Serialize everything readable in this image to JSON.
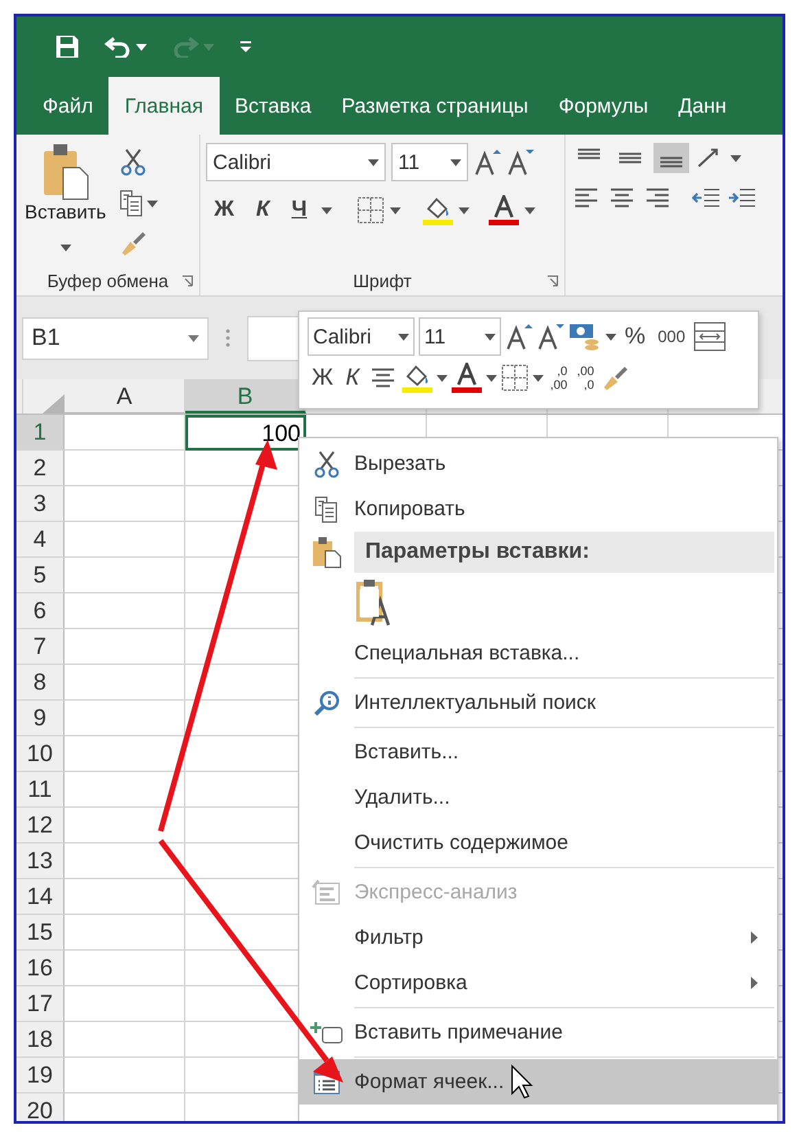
{
  "quick_access": [
    {
      "kind": "save",
      "disabled": false
    },
    {
      "kind": "undo",
      "disabled": false
    },
    {
      "kind": "redo",
      "disabled": true
    },
    {
      "kind": "customize",
      "disabled": false
    }
  ],
  "tabs": [
    {
      "label": "Файл",
      "selected": false
    },
    {
      "label": "Главная",
      "selected": true
    },
    {
      "label": "Вставка",
      "selected": false
    },
    {
      "label": "Разметка страницы",
      "selected": false
    },
    {
      "label": "Формулы",
      "selected": false
    },
    {
      "label": "Данн",
      "selected": false
    }
  ],
  "ribbon": {
    "clipboard": {
      "paste_label": "Вставить",
      "group_label": "Буфер обмена"
    },
    "font": {
      "font_name": "Calibri",
      "font_size": "11",
      "bold": "Ж",
      "italic": "К",
      "underline": "Ч",
      "group_label": "Шрифт"
    },
    "alignment": [
      {
        "kind": "top",
        "selected": false
      },
      {
        "kind": "middle",
        "selected": false
      },
      {
        "kind": "bottom",
        "selected": true
      }
    ]
  },
  "name_box": "B1",
  "mini_toolbar": {
    "font_name": "Calibri",
    "font_size": "11",
    "percent": "%",
    "thousands": "000",
    "bold": "Ж",
    "italic": "К",
    "increase_decimal": [
      ",0",
      ",00"
    ],
    "decrease_decimal": [
      ",00",
      ",0"
    ]
  },
  "sheet": {
    "columns": [
      {
        "label": "A",
        "selected": false
      },
      {
        "label": "B",
        "selected": true
      }
    ],
    "rows": [
      {
        "label": "1",
        "selected": true,
        "cells": [
          {},
          {
            "text": "100",
            "selected": true
          }
        ]
      },
      {
        "label": "2",
        "selected": false
      },
      {
        "label": "3",
        "selected": false
      },
      {
        "label": "4",
        "selected": false
      },
      {
        "label": "5",
        "selected": false
      },
      {
        "label": "6",
        "selected": false
      },
      {
        "label": "7",
        "selected": false
      },
      {
        "label": "8",
        "selected": false
      },
      {
        "label": "9",
        "selected": false
      },
      {
        "label": "10",
        "selected": false
      },
      {
        "label": "11",
        "selected": false
      },
      {
        "label": "12",
        "selected": false
      },
      {
        "label": "13",
        "selected": false
      },
      {
        "label": "14",
        "selected": false
      },
      {
        "label": "15",
        "selected": false
      },
      {
        "label": "16",
        "selected": false
      },
      {
        "label": "17",
        "selected": false
      },
      {
        "label": "18",
        "selected": false
      },
      {
        "label": "19",
        "selected": false
      },
      {
        "label": "20",
        "selected": false
      }
    ]
  },
  "context_menu": [
    {
      "kind": "cut",
      "label": "Вырезать",
      "disabled": false,
      "submenu": false,
      "selected": false
    },
    {
      "kind": "copy",
      "label": "Копировать",
      "disabled": false,
      "submenu": false,
      "selected": false
    },
    {
      "kind": "header",
      "label": "Параметры вставки:"
    },
    {
      "kind": "paste_options"
    },
    {
      "kind": "item",
      "label": "Специальная вставка...",
      "disabled": false,
      "submenu": false,
      "selected": false
    },
    {
      "kind": "separator"
    },
    {
      "kind": "lookup",
      "label": "Интеллектуальный поиск",
      "disabled": false,
      "submenu": false,
      "selected": false
    },
    {
      "kind": "separator"
    },
    {
      "kind": "item",
      "label": "Вставить...",
      "disabled": false,
      "submenu": false,
      "selected": false
    },
    {
      "kind": "item",
      "label": "Удалить...",
      "disabled": false,
      "submenu": false,
      "selected": false
    },
    {
      "kind": "item",
      "label": "Очистить содержимое",
      "disabled": false,
      "submenu": false,
      "selected": false
    },
    {
      "kind": "separator"
    },
    {
      "kind": "analysis",
      "label": "Экспресс-анализ",
      "disabled": true,
      "submenu": false,
      "selected": false
    },
    {
      "kind": "item",
      "label": "Фильтр",
      "disabled": false,
      "submenu": true,
      "selected": false
    },
    {
      "kind": "item",
      "label": "Сортировка",
      "disabled": false,
      "submenu": true,
      "selected": false
    },
    {
      "kind": "separator"
    },
    {
      "kind": "comment",
      "label": "Вставить примечание",
      "disabled": false,
      "submenu": false,
      "selected": false
    },
    {
      "kind": "separator"
    },
    {
      "kind": "format",
      "label": "Формат ячеек...",
      "disabled": false,
      "submenu": false,
      "selected": true
    }
  ]
}
